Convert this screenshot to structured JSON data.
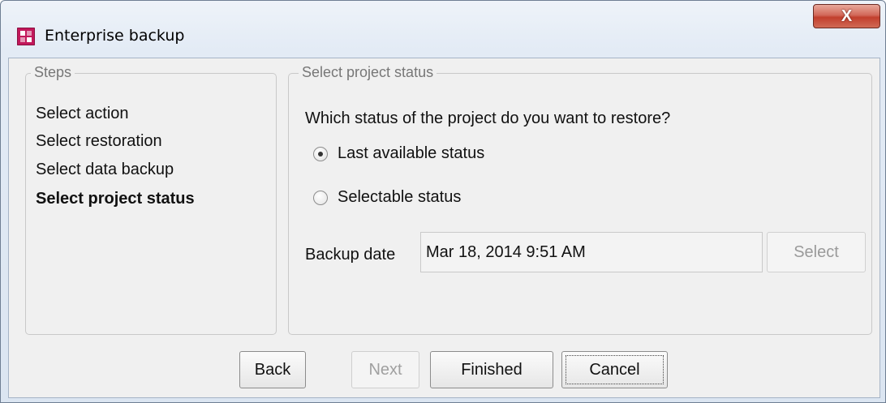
{
  "window": {
    "title": "Enterprise backup",
    "close_glyph": "X",
    "icon": "app-logo-icon"
  },
  "steps": {
    "legend": "Steps",
    "items": [
      {
        "label": "Select action",
        "active": false
      },
      {
        "label": "Select restoration",
        "active": false
      },
      {
        "label": "Select data backup",
        "active": false
      },
      {
        "label": "Select project status",
        "active": true
      }
    ]
  },
  "status": {
    "legend": "Select project status",
    "question": "Which status of the project do you want to restore?",
    "options": [
      {
        "label": "Last available status",
        "selected": true
      },
      {
        "label": "Selectable status",
        "selected": false
      }
    ],
    "backup_date_label": "Backup date",
    "backup_date_value": "Mar 18, 2014 9:51 AM",
    "select_label": "Select"
  },
  "buttons": {
    "back": "Back",
    "next": "Next",
    "finished": "Finished",
    "cancel": "Cancel"
  },
  "colors": {
    "title_gradient_top": "#eef3f9",
    "close_button": "#c23f2d",
    "app_icon": "#c2185b",
    "dialog_bg": "#f0f0f0"
  }
}
